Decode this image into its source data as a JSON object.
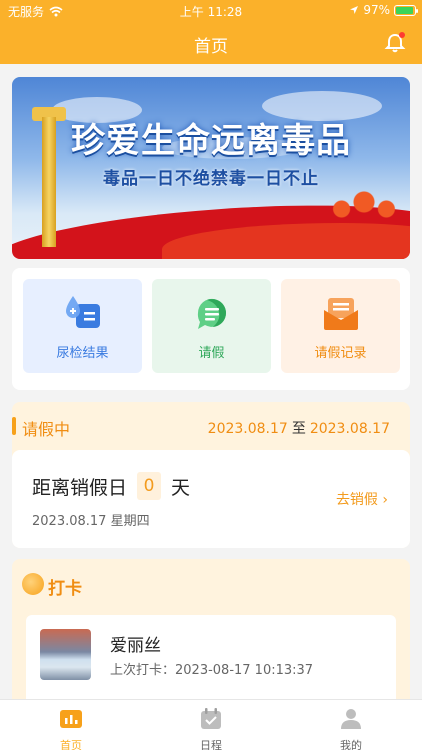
{
  "status_bar": {
    "carrier": "无服务",
    "time": "上午 11:28",
    "battery": "97%",
    "battery_level": 0.97
  },
  "nav": {
    "title": "首页"
  },
  "banner": {
    "headline": "珍爱生命远离毒品",
    "subline": "毒品一日不绝禁毒一日不止"
  },
  "quick_actions": [
    {
      "label": "尿检结果",
      "icon": "urine-test-icon",
      "color": "#3a7be0",
      "bg": "#e7efff"
    },
    {
      "label": "请假",
      "icon": "leave-request-icon",
      "color": "#2fa85a",
      "bg": "#e8f6ec"
    },
    {
      "label": "请假记录",
      "icon": "leave-record-icon",
      "color": "#f08d12",
      "bg": "#fff1e5"
    }
  ],
  "leave": {
    "status": "请假中",
    "start": "2023.08.17",
    "to": "至",
    "end": "2023.08.17",
    "remain_prefix": "距离销假日",
    "remain_days": "0",
    "remain_suffix": "天",
    "date": "2023.08.17 星期四",
    "action": "去销假 ›"
  },
  "checkin": {
    "title": "打卡",
    "name": "爱丽丝",
    "last_checkin": "上次打卡：2023-08-17 10:13:37"
  },
  "tabbar": [
    {
      "label": "首页",
      "icon": "home-icon",
      "active": true
    },
    {
      "label": "日程",
      "icon": "calendar-icon",
      "active": false
    },
    {
      "label": "我的",
      "icon": "profile-icon",
      "active": false
    }
  ],
  "colors": {
    "accent": "#fbb12a",
    "accent_text": "#f08d12"
  }
}
